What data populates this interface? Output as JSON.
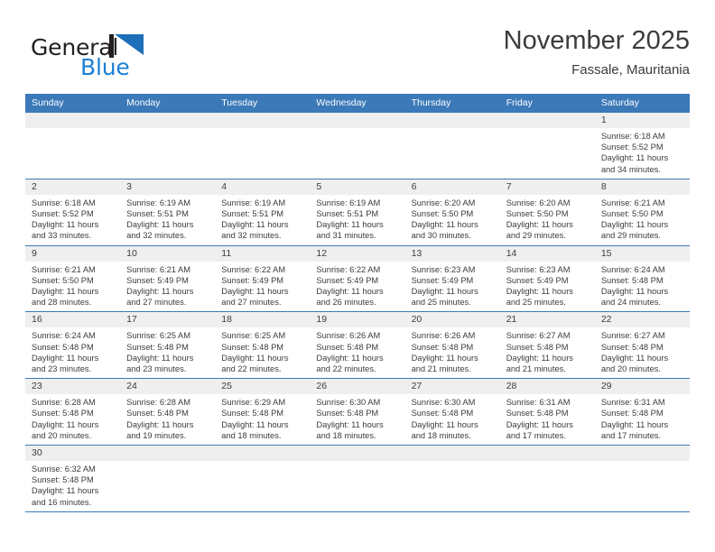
{
  "brand": {
    "name_part1": "General",
    "name_part2": "Blue",
    "flag_icon": "blue-triangle-flag-icon",
    "flag_color": "#1c7fd4"
  },
  "header": {
    "title": "November 2025",
    "subtitle": "Fassale, Mauritania"
  },
  "theme": {
    "header_blue": "#3b79b8",
    "date_strip_gray": "#efefef",
    "text_color": "#3c3c3c"
  },
  "weekday_headers": [
    "Sunday",
    "Monday",
    "Tuesday",
    "Wednesday",
    "Thursday",
    "Friday",
    "Saturday"
  ],
  "weeks": [
    [
      {
        "blank": true,
        "date": "",
        "sunrise": "",
        "sunset": "",
        "daylight1": "",
        "daylight2": ""
      },
      {
        "blank": true,
        "date": "",
        "sunrise": "",
        "sunset": "",
        "daylight1": "",
        "daylight2": ""
      },
      {
        "blank": true,
        "date": "",
        "sunrise": "",
        "sunset": "",
        "daylight1": "",
        "daylight2": ""
      },
      {
        "blank": true,
        "date": "",
        "sunrise": "",
        "sunset": "",
        "daylight1": "",
        "daylight2": ""
      },
      {
        "blank": true,
        "date": "",
        "sunrise": "",
        "sunset": "",
        "daylight1": "",
        "daylight2": ""
      },
      {
        "blank": true,
        "date": "",
        "sunrise": "",
        "sunset": "",
        "daylight1": "",
        "daylight2": ""
      },
      {
        "blank": false,
        "date": "1",
        "sunrise": "Sunrise: 6:18 AM",
        "sunset": "Sunset: 5:52 PM",
        "daylight1": "Daylight: 11 hours",
        "daylight2": "and 34 minutes."
      }
    ],
    [
      {
        "blank": false,
        "date": "2",
        "sunrise": "Sunrise: 6:18 AM",
        "sunset": "Sunset: 5:52 PM",
        "daylight1": "Daylight: 11 hours",
        "daylight2": "and 33 minutes."
      },
      {
        "blank": false,
        "date": "3",
        "sunrise": "Sunrise: 6:19 AM",
        "sunset": "Sunset: 5:51 PM",
        "daylight1": "Daylight: 11 hours",
        "daylight2": "and 32 minutes."
      },
      {
        "blank": false,
        "date": "4",
        "sunrise": "Sunrise: 6:19 AM",
        "sunset": "Sunset: 5:51 PM",
        "daylight1": "Daylight: 11 hours",
        "daylight2": "and 32 minutes."
      },
      {
        "blank": false,
        "date": "5",
        "sunrise": "Sunrise: 6:19 AM",
        "sunset": "Sunset: 5:51 PM",
        "daylight1": "Daylight: 11 hours",
        "daylight2": "and 31 minutes."
      },
      {
        "blank": false,
        "date": "6",
        "sunrise": "Sunrise: 6:20 AM",
        "sunset": "Sunset: 5:50 PM",
        "daylight1": "Daylight: 11 hours",
        "daylight2": "and 30 minutes."
      },
      {
        "blank": false,
        "date": "7",
        "sunrise": "Sunrise: 6:20 AM",
        "sunset": "Sunset: 5:50 PM",
        "daylight1": "Daylight: 11 hours",
        "daylight2": "and 29 minutes."
      },
      {
        "blank": false,
        "date": "8",
        "sunrise": "Sunrise: 6:21 AM",
        "sunset": "Sunset: 5:50 PM",
        "daylight1": "Daylight: 11 hours",
        "daylight2": "and 29 minutes."
      }
    ],
    [
      {
        "blank": false,
        "date": "9",
        "sunrise": "Sunrise: 6:21 AM",
        "sunset": "Sunset: 5:50 PM",
        "daylight1": "Daylight: 11 hours",
        "daylight2": "and 28 minutes."
      },
      {
        "blank": false,
        "date": "10",
        "sunrise": "Sunrise: 6:21 AM",
        "sunset": "Sunset: 5:49 PM",
        "daylight1": "Daylight: 11 hours",
        "daylight2": "and 27 minutes."
      },
      {
        "blank": false,
        "date": "11",
        "sunrise": "Sunrise: 6:22 AM",
        "sunset": "Sunset: 5:49 PM",
        "daylight1": "Daylight: 11 hours",
        "daylight2": "and 27 minutes."
      },
      {
        "blank": false,
        "date": "12",
        "sunrise": "Sunrise: 6:22 AM",
        "sunset": "Sunset: 5:49 PM",
        "daylight1": "Daylight: 11 hours",
        "daylight2": "and 26 minutes."
      },
      {
        "blank": false,
        "date": "13",
        "sunrise": "Sunrise: 6:23 AM",
        "sunset": "Sunset: 5:49 PM",
        "daylight1": "Daylight: 11 hours",
        "daylight2": "and 25 minutes."
      },
      {
        "blank": false,
        "date": "14",
        "sunrise": "Sunrise: 6:23 AM",
        "sunset": "Sunset: 5:49 PM",
        "daylight1": "Daylight: 11 hours",
        "daylight2": "and 25 minutes."
      },
      {
        "blank": false,
        "date": "15",
        "sunrise": "Sunrise: 6:24 AM",
        "sunset": "Sunset: 5:48 PM",
        "daylight1": "Daylight: 11 hours",
        "daylight2": "and 24 minutes."
      }
    ],
    [
      {
        "blank": false,
        "date": "16",
        "sunrise": "Sunrise: 6:24 AM",
        "sunset": "Sunset: 5:48 PM",
        "daylight1": "Daylight: 11 hours",
        "daylight2": "and 23 minutes."
      },
      {
        "blank": false,
        "date": "17",
        "sunrise": "Sunrise: 6:25 AM",
        "sunset": "Sunset: 5:48 PM",
        "daylight1": "Daylight: 11 hours",
        "daylight2": "and 23 minutes."
      },
      {
        "blank": false,
        "date": "18",
        "sunrise": "Sunrise: 6:25 AM",
        "sunset": "Sunset: 5:48 PM",
        "daylight1": "Daylight: 11 hours",
        "daylight2": "and 22 minutes."
      },
      {
        "blank": false,
        "date": "19",
        "sunrise": "Sunrise: 6:26 AM",
        "sunset": "Sunset: 5:48 PM",
        "daylight1": "Daylight: 11 hours",
        "daylight2": "and 22 minutes."
      },
      {
        "blank": false,
        "date": "20",
        "sunrise": "Sunrise: 6:26 AM",
        "sunset": "Sunset: 5:48 PM",
        "daylight1": "Daylight: 11 hours",
        "daylight2": "and 21 minutes."
      },
      {
        "blank": false,
        "date": "21",
        "sunrise": "Sunrise: 6:27 AM",
        "sunset": "Sunset: 5:48 PM",
        "daylight1": "Daylight: 11 hours",
        "daylight2": "and 21 minutes."
      },
      {
        "blank": false,
        "date": "22",
        "sunrise": "Sunrise: 6:27 AM",
        "sunset": "Sunset: 5:48 PM",
        "daylight1": "Daylight: 11 hours",
        "daylight2": "and 20 minutes."
      }
    ],
    [
      {
        "blank": false,
        "date": "23",
        "sunrise": "Sunrise: 6:28 AM",
        "sunset": "Sunset: 5:48 PM",
        "daylight1": "Daylight: 11 hours",
        "daylight2": "and 20 minutes."
      },
      {
        "blank": false,
        "date": "24",
        "sunrise": "Sunrise: 6:28 AM",
        "sunset": "Sunset: 5:48 PM",
        "daylight1": "Daylight: 11 hours",
        "daylight2": "and 19 minutes."
      },
      {
        "blank": false,
        "date": "25",
        "sunrise": "Sunrise: 6:29 AM",
        "sunset": "Sunset: 5:48 PM",
        "daylight1": "Daylight: 11 hours",
        "daylight2": "and 18 minutes."
      },
      {
        "blank": false,
        "date": "26",
        "sunrise": "Sunrise: 6:30 AM",
        "sunset": "Sunset: 5:48 PM",
        "daylight1": "Daylight: 11 hours",
        "daylight2": "and 18 minutes."
      },
      {
        "blank": false,
        "date": "27",
        "sunrise": "Sunrise: 6:30 AM",
        "sunset": "Sunset: 5:48 PM",
        "daylight1": "Daylight: 11 hours",
        "daylight2": "and 18 minutes."
      },
      {
        "blank": false,
        "date": "28",
        "sunrise": "Sunrise: 6:31 AM",
        "sunset": "Sunset: 5:48 PM",
        "daylight1": "Daylight: 11 hours",
        "daylight2": "and 17 minutes."
      },
      {
        "blank": false,
        "date": "29",
        "sunrise": "Sunrise: 6:31 AM",
        "sunset": "Sunset: 5:48 PM",
        "daylight1": "Daylight: 11 hours",
        "daylight2": "and 17 minutes."
      }
    ],
    [
      {
        "blank": false,
        "date": "30",
        "sunrise": "Sunrise: 6:32 AM",
        "sunset": "Sunset: 5:48 PM",
        "daylight1": "Daylight: 11 hours",
        "daylight2": "and 16 minutes."
      },
      {
        "blank": true,
        "date": "",
        "sunrise": "",
        "sunset": "",
        "daylight1": "",
        "daylight2": ""
      },
      {
        "blank": true,
        "date": "",
        "sunrise": "",
        "sunset": "",
        "daylight1": "",
        "daylight2": ""
      },
      {
        "blank": true,
        "date": "",
        "sunrise": "",
        "sunset": "",
        "daylight1": "",
        "daylight2": ""
      },
      {
        "blank": true,
        "date": "",
        "sunrise": "",
        "sunset": "",
        "daylight1": "",
        "daylight2": ""
      },
      {
        "blank": true,
        "date": "",
        "sunrise": "",
        "sunset": "",
        "daylight1": "",
        "daylight2": ""
      },
      {
        "blank": true,
        "date": "",
        "sunrise": "",
        "sunset": "",
        "daylight1": "",
        "daylight2": ""
      }
    ]
  ]
}
